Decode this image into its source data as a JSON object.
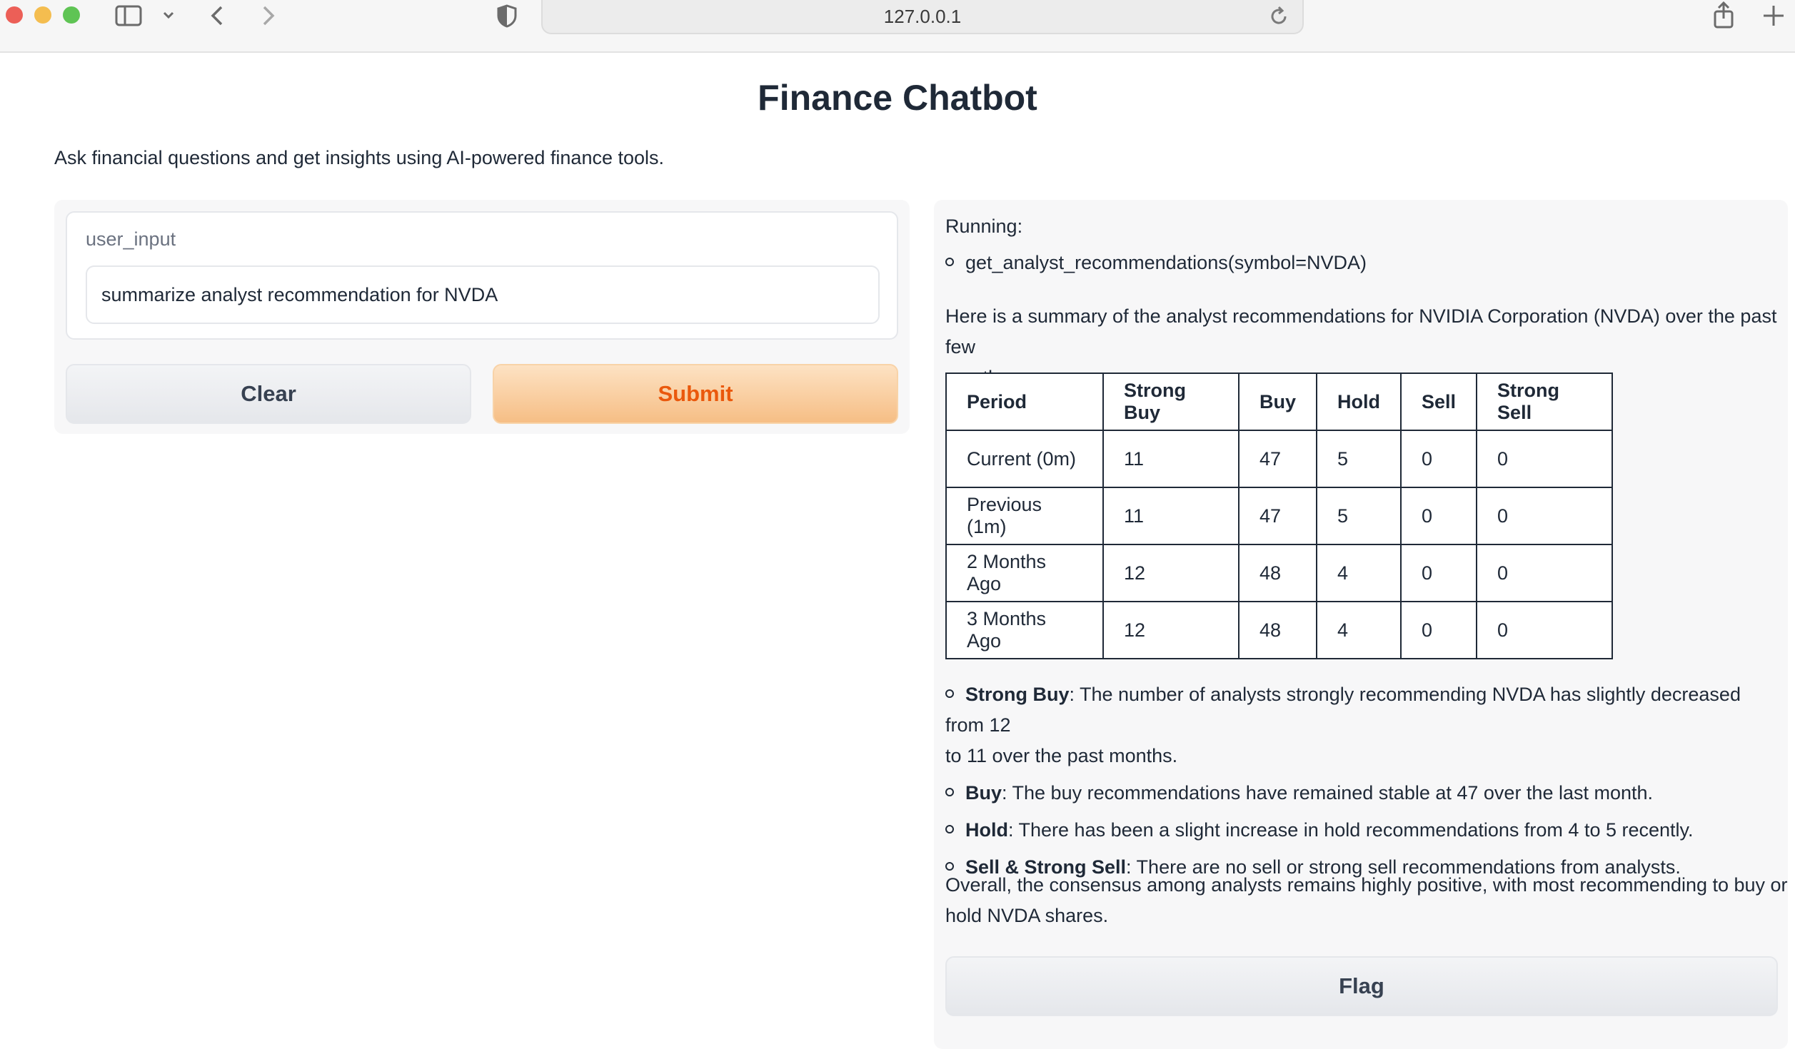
{
  "browser": {
    "url": "127.0.0.1",
    "icons": [
      "sidebar-icon",
      "chevron-down-icon",
      "back-icon",
      "forward-icon",
      "shield-icon",
      "reload-icon",
      "share-icon",
      "new-tab-icon"
    ]
  },
  "page": {
    "title": "Finance Chatbot",
    "description": "Ask financial questions and get insights using AI-powered finance tools."
  },
  "input": {
    "label": "user_input",
    "value": "summarize analyst recommendation for NVDA"
  },
  "buttons": {
    "clear": "Clear",
    "submit": "Submit",
    "flag": "Flag"
  },
  "output": {
    "running_label": "Running:",
    "tool_call": "get_analyst_recommendations(symbol=NVDA)",
    "intro_line1": "Here is a summary of the analyst recommendations for NVIDIA Corporation (NVDA) over the past few",
    "intro_line2": "months:",
    "table": {
      "headers": [
        "Period",
        "Strong Buy",
        "Buy",
        "Hold",
        "Sell",
        "Strong Sell"
      ],
      "rows": [
        [
          "Current (0m)",
          "11",
          "47",
          "5",
          "0",
          "0"
        ],
        [
          "Previous (1m)",
          "11",
          "47",
          "5",
          "0",
          "0"
        ],
        [
          "2 Months Ago",
          "12",
          "48",
          "4",
          "0",
          "0"
        ],
        [
          "3 Months Ago",
          "12",
          "48",
          "4",
          "0",
          "0"
        ]
      ]
    },
    "bullets": [
      {
        "term": "Strong Buy",
        "text_line1": ": The number of analysts strongly recommending NVDA has slightly decreased from 12",
        "text_line2": "to 11 over the past months."
      },
      {
        "term": "Buy",
        "text_line1": ": The buy recommendations have remained stable at 47 over the last month."
      },
      {
        "term": "Hold",
        "text_line1": ": There has been a slight increase in hold recommendations from 4 to 5 recently."
      },
      {
        "term": "Sell & Strong Sell",
        "text_line1": ": There are no sell or strong sell recommendations from analysts."
      }
    ],
    "conclusion_line1": "Overall, the consensus among analysts remains highly positive, with most recommending to buy or",
    "conclusion_line2": "hold NVDA shares."
  },
  "colors": {
    "submit_text": "#ea580c",
    "submit_bg": "#f6be85",
    "panel_bg": "#f7f7f8"
  }
}
